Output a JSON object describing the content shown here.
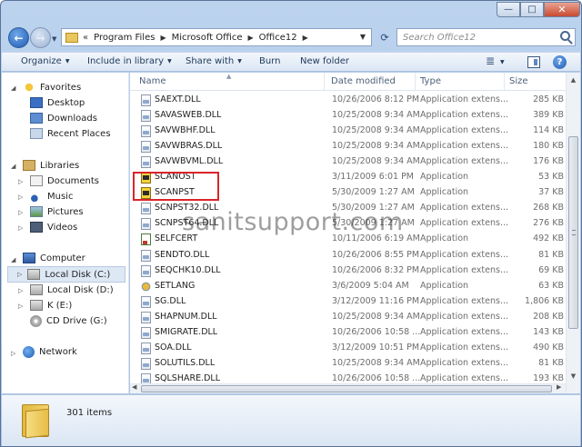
{
  "window": {
    "controls": {
      "minimize": "—",
      "maximize": "□",
      "close": "✕"
    }
  },
  "address": {
    "prefix": "«",
    "crumbs": [
      "Program Files",
      "Microsoft Office",
      "Office12"
    ],
    "search_placeholder": "Search Office12"
  },
  "toolbar": {
    "organize": "Organize",
    "include": "Include in library",
    "share": "Share with",
    "burn": "Burn",
    "new_folder": "New folder"
  },
  "nav": {
    "favorites": "Favorites",
    "desktop": "Desktop",
    "downloads": "Downloads",
    "recent": "Recent Places",
    "libraries": "Libraries",
    "documents": "Documents",
    "music": "Music",
    "pictures": "Pictures",
    "videos": "Videos",
    "computer": "Computer",
    "local_c": "Local Disk (C:)",
    "local_d": "Local Disk (D:)",
    "k": "K (E:)",
    "cd": "CD Drive (G:)",
    "network": "Network"
  },
  "columns": {
    "name": "Name",
    "date": "Date modified",
    "type": "Type",
    "size": "Size"
  },
  "files": [
    {
      "name": "SAEXT.DLL",
      "date": "10/26/2006 8:12 PM",
      "type": "Application extens...",
      "size": "285 KB",
      "icon": "dll"
    },
    {
      "name": "SAVASWEB.DLL",
      "date": "10/25/2008 9:34 AM",
      "type": "Application extens...",
      "size": "389 KB",
      "icon": "dll"
    },
    {
      "name": "SAVWBHF.DLL",
      "date": "10/25/2008 9:34 AM",
      "type": "Application extens...",
      "size": "114 KB",
      "icon": "dll"
    },
    {
      "name": "SAVWBRAS.DLL",
      "date": "10/25/2008 9:34 AM",
      "type": "Application extens...",
      "size": "180 KB",
      "icon": "dll"
    },
    {
      "name": "SAVWBVML.DLL",
      "date": "10/25/2008 9:34 AM",
      "type": "Application extens...",
      "size": "176 KB",
      "icon": "dll"
    },
    {
      "name": "SCANOST",
      "date": "3/11/2009 6:01 PM",
      "type": "Application",
      "size": "53 KB",
      "icon": "app"
    },
    {
      "name": "SCANPST",
      "date": "5/30/2009 1:27 AM",
      "type": "Application",
      "size": "37 KB",
      "icon": "app"
    },
    {
      "name": "SCNPST32.DLL",
      "date": "5/30/2009 1:27 AM",
      "type": "Application extens...",
      "size": "268 KB",
      "icon": "dll"
    },
    {
      "name": "SCNPST64.DLL",
      "date": "5/30/2009 1:27 AM",
      "type": "Application extens...",
      "size": "276 KB",
      "icon": "dll"
    },
    {
      "name": "SELFCERT",
      "date": "10/11/2006 6:19 AM",
      "type": "Application",
      "size": "492 KB",
      "icon": "cert"
    },
    {
      "name": "SENDTO.DLL",
      "date": "10/26/2006 8:55 PM",
      "type": "Application extens...",
      "size": "81 KB",
      "icon": "dll"
    },
    {
      "name": "SEQCHK10.DLL",
      "date": "10/26/2006 8:32 PM",
      "type": "Application extens...",
      "size": "69 KB",
      "icon": "dll"
    },
    {
      "name": "SETLANG",
      "date": "3/6/2009 5:04 AM",
      "type": "Application",
      "size": "63 KB",
      "icon": "lang"
    },
    {
      "name": "SG.DLL",
      "date": "3/12/2009 11:16 PM",
      "type": "Application extens...",
      "size": "1,806 KB",
      "icon": "dll"
    },
    {
      "name": "SHAPNUM.DLL",
      "date": "10/25/2008 9:34 AM",
      "type": "Application extens...",
      "size": "208 KB",
      "icon": "dll"
    },
    {
      "name": "SMIGRATE.DLL",
      "date": "10/26/2006 10:58 ...",
      "type": "Application extens...",
      "size": "143 KB",
      "icon": "dll"
    },
    {
      "name": "SOA.DLL",
      "date": "3/12/2009 10:51 PM",
      "type": "Application extens...",
      "size": "490 KB",
      "icon": "dll"
    },
    {
      "name": "SOLUTILS.DLL",
      "date": "10/25/2008 9:34 AM",
      "type": "Application extens...",
      "size": "81 KB",
      "icon": "dll"
    },
    {
      "name": "SQLSHARE.DLL",
      "date": "10/26/2006 10:58 ...",
      "type": "Application extens...",
      "size": "193 KB",
      "icon": "dll"
    }
  ],
  "watermark": "sanitsupport.com",
  "status": {
    "item_count": "301 items"
  }
}
